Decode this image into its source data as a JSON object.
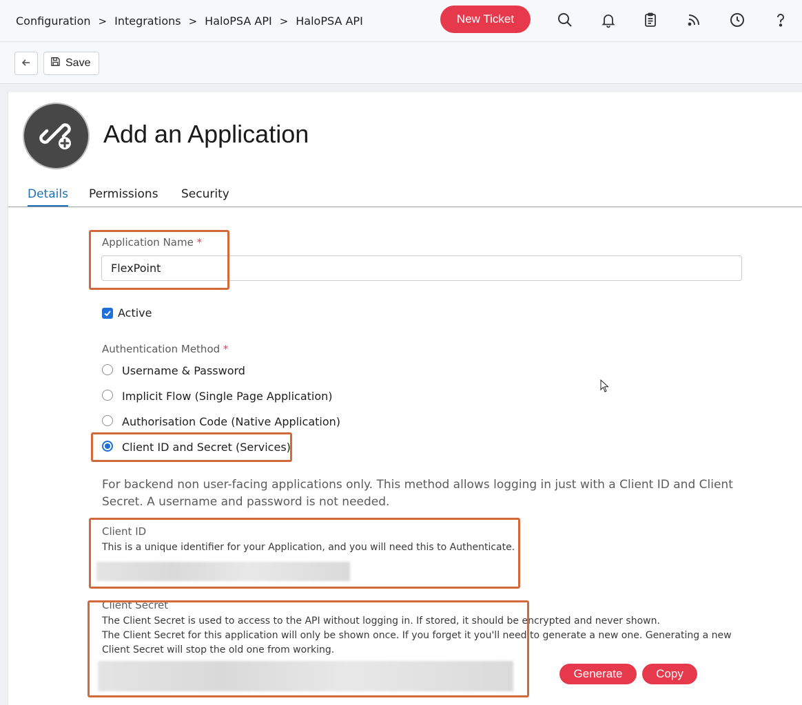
{
  "breadcrumb": [
    "Configuration",
    "Integrations",
    "HaloPSA API",
    "HaloPSA API"
  ],
  "breadcrumb_sep": ">",
  "header": {
    "new_ticket": "New Ticket",
    "icons": [
      "search-icon",
      "bell-icon",
      "clipboard-icon",
      "rss-icon",
      "clock-icon",
      "help-icon"
    ]
  },
  "toolbar": {
    "save_label": "Save"
  },
  "page": {
    "title": "Add an Application"
  },
  "tabs": [
    "Details",
    "Permissions",
    "Security"
  ],
  "form": {
    "app_name_label": "Application Name",
    "app_name_value": "FlexPoint",
    "required_mark": "*",
    "active_label": "Active",
    "active_checked": true,
    "auth_label": "Authentication Method",
    "auth_options": [
      "Username & Password",
      "Implicit Flow (Single Page Application)",
      "Authorisation Code (Native Application)",
      "Client ID and Secret (Services)"
    ],
    "auth_selected": "Client ID and Secret (Services)",
    "auth_desc": "For backend non user-facing applications only. This method allows logging in just with a Client ID and Client Secret. A username and password is not needed.",
    "client_id_label": "Client ID",
    "client_id_help": "This is a unique identifier for your Application, and you will need this to Authenticate.",
    "client_secret_label": "Client Secret",
    "client_secret_help1": "The Client Secret is used to access to the API without logging in. If stored, it should be encrypted and never shown.",
    "client_secret_help2": "The Client Secret for this application will only be shown once. If you forget it you'll need to generate a new one. Generating a new Client Secret will stop the old one from working.",
    "generate_label": "Generate",
    "copy_label": "Copy"
  },
  "colors": {
    "accent": "#e6394c",
    "link": "#1e6fb8",
    "highlight": "#d2693a"
  }
}
